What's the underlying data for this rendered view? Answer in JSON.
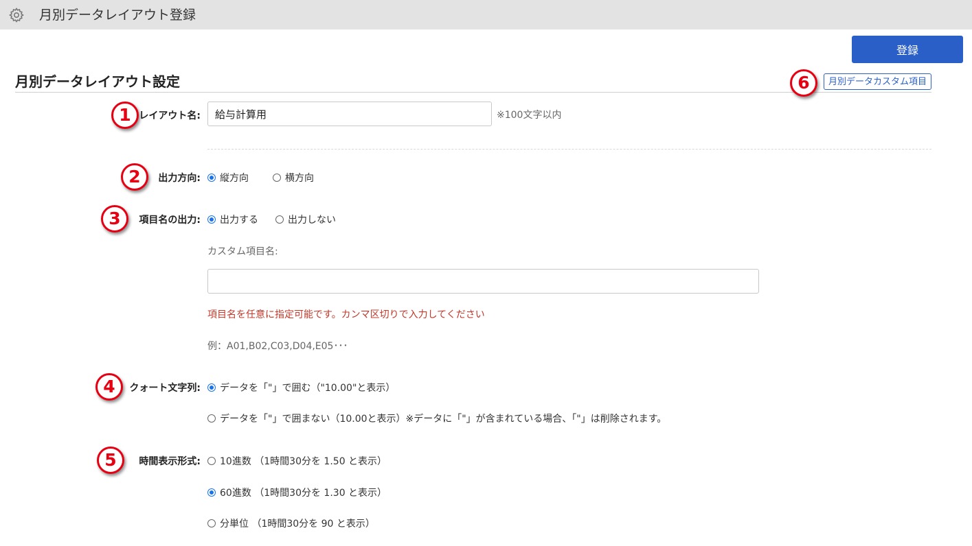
{
  "header": {
    "title": "月別データレイアウト登録",
    "icon": "gear-icon"
  },
  "toolbar": {
    "submit_label": "登録",
    "custom_items_link": "月別データカスタム項目"
  },
  "section": {
    "title": "月別データレイアウト設定"
  },
  "markers": [
    "1",
    "2",
    "3",
    "4",
    "5",
    "6"
  ],
  "colors": {
    "accent": "#2a5fc8",
    "marker": "#e60012",
    "warning": "#c0392b",
    "radio_on": "#1a73e8"
  },
  "form": {
    "layout_name": {
      "label": "レイアウト名:",
      "value": "給与計算用",
      "hint": "※100文字以内"
    },
    "orientation": {
      "label": "出力方向:",
      "options": [
        "縦方向",
        "横方向"
      ],
      "selected": "縦方向"
    },
    "item_name_output": {
      "label": "項目名の出力:",
      "options": [
        "出力する",
        "出力しない"
      ],
      "selected": "出力する",
      "custom_label": "カスタム項目名:",
      "custom_value": "",
      "warning": "項目名を任意に指定可能です。カンマ区切りで入力してください",
      "example": "例：A01,B02,C03,D04,E05･･･"
    },
    "quote": {
      "label": "クォート文字列:",
      "options": [
        "データを「\"」で囲む（\"10.00\"と表示）",
        "データを「\"」で囲まない（10.00と表示）※データに「\"」が含まれている場合、「\"」は削除されます。"
      ],
      "selected": "データを「\"」で囲む（\"10.00\"と表示）"
    },
    "time_format": {
      "label": "時間表示形式:",
      "options": [
        "10進数 （1時間30分を 1.50 と表示）",
        "60進数 （1時間30分を 1.30 と表示）",
        "分単位 （1時間30分を 90 と表示）"
      ],
      "selected": "60進数 （1時間30分を 1.30 と表示）"
    }
  }
}
